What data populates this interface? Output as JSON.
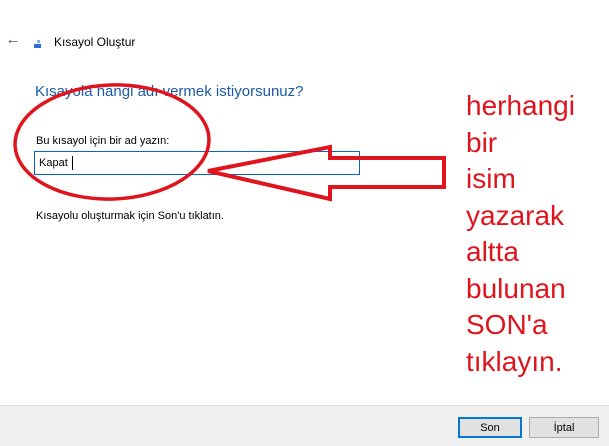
{
  "window": {
    "title": "Kısayol Oluştur",
    "back_icon": "back-arrow-icon",
    "app_icon": "shortcut-icon"
  },
  "main": {
    "heading": "Kısayola hangi adı vermek istiyorsunuz?",
    "field_label": "Bu kısayol için bir ad yazın:",
    "name_value": "Kapat",
    "instruction": "Kısayolu oluşturmak için Son'u tıklatın."
  },
  "annotation": {
    "lines": [
      "herhangi",
      "bir",
      "isim",
      "yazarak",
      "altta",
      "bulunan",
      "SON'a",
      "tıklayın."
    ],
    "color": "#e0141c"
  },
  "footer": {
    "finish_label": "Son",
    "cancel_label": "İptal"
  },
  "colors": {
    "heading": "#1b5aa8",
    "input_border": "#0a64c8",
    "finish_border": "#0078d7"
  }
}
